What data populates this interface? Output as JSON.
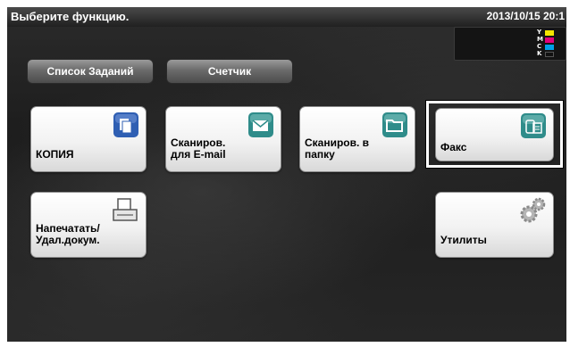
{
  "header": {
    "title": "Выберите функцию.",
    "datetime": "2013/10/15 20:1"
  },
  "toner": [
    {
      "letter": "Y",
      "color": "#f5e400"
    },
    {
      "letter": "M",
      "color": "#e0007a"
    },
    {
      "letter": "C",
      "color": "#00a0e8"
    },
    {
      "letter": "K",
      "color": "#111111"
    }
  ],
  "top_buttons": {
    "jobs_label": "Список Заданий",
    "counter_label": "Счетчик"
  },
  "tiles": {
    "copy": "КОПИЯ",
    "scan_email": "Сканиров.\nдля E-mail",
    "scan_folder": "Сканиров. в\nпапку",
    "fax": "Факс",
    "print": "Напечатать/\nУдал.докум.",
    "utilities": "Утилиты"
  },
  "selected_tile": "fax",
  "colors": {
    "icon_blue": "#2f5fb3",
    "icon_teal": "#2f8c8a",
    "icon_gray": "#9a9a9a"
  }
}
